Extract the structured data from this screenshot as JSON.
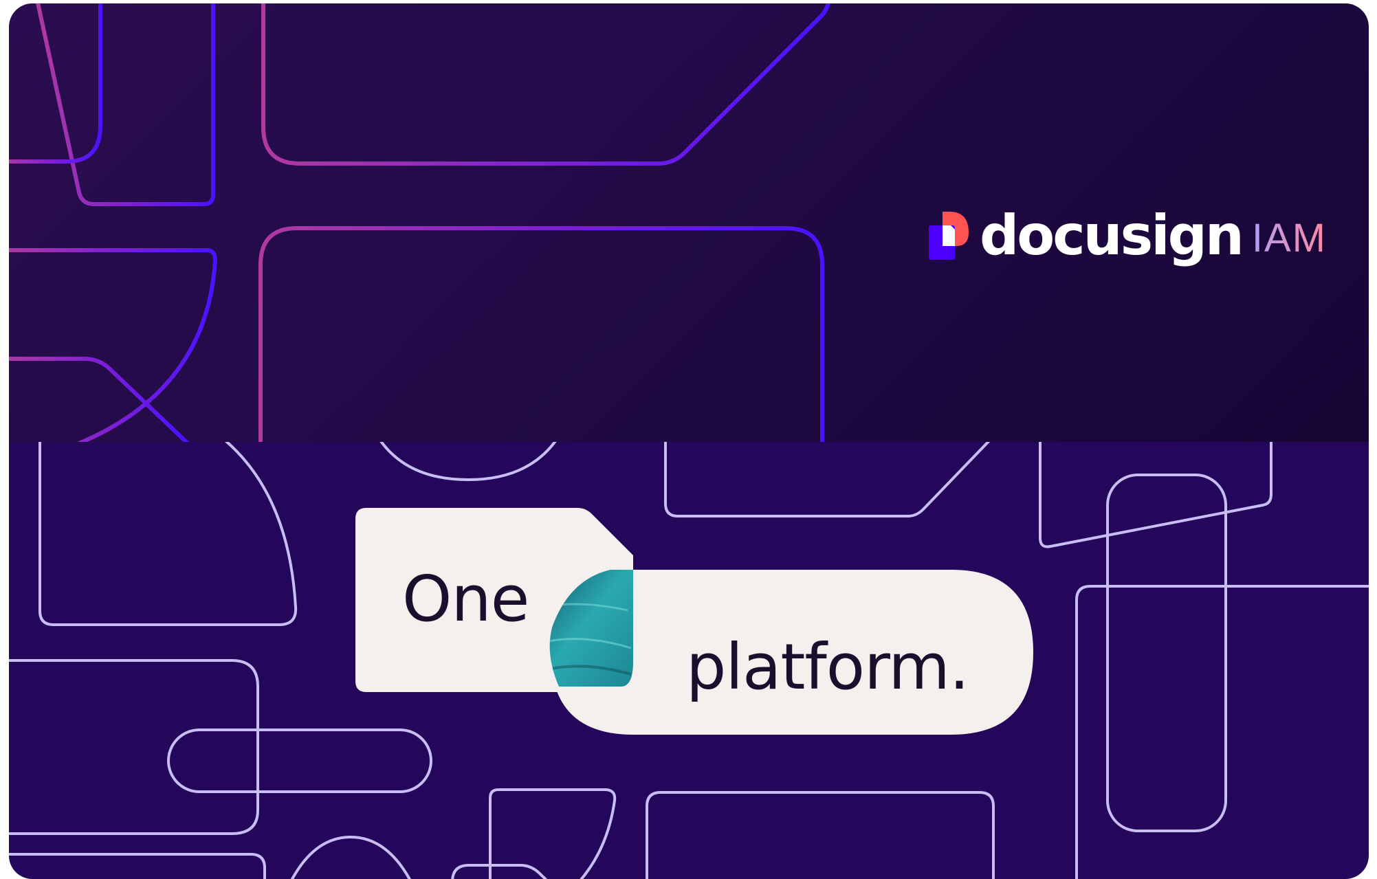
{
  "brand": {
    "wordmark": "docusign",
    "product": "IAM"
  },
  "tagline": {
    "word1": "One",
    "word2": "platform."
  },
  "colors": {
    "top_background": "#220a47",
    "bottom_background": "#24075a",
    "pill_fill": "#f4f0ed",
    "outline_light": "#c8bdf5",
    "logo_red": "#ff5252",
    "logo_blue": "#4c00ff",
    "water_accent": "#2aa9b0"
  }
}
